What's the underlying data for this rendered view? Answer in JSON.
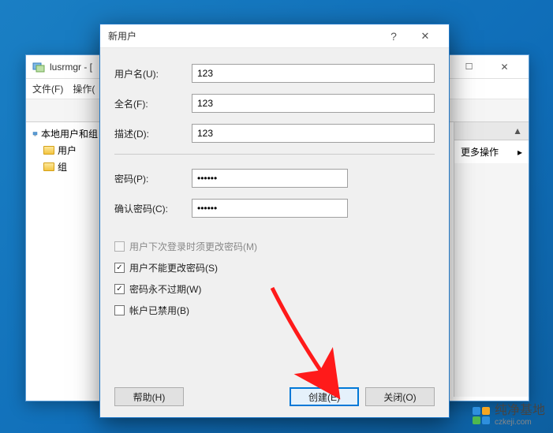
{
  "parent": {
    "title": "lusrmgr - [",
    "menu": {
      "file": "文件(F)",
      "action": "操作("
    },
    "tree": {
      "root": "本地用户和组",
      "users": "用户",
      "groups": "组"
    },
    "actions": {
      "header": "▲",
      "more": "更多操作",
      "arrow": "▸"
    }
  },
  "dialog": {
    "title": "新用户",
    "labels": {
      "username": "用户名(U):",
      "fullname": "全名(F):",
      "description": "描述(D):",
      "password": "密码(P):",
      "confirm": "确认密码(C):"
    },
    "values": {
      "username": "123",
      "fullname": "123",
      "description": "123",
      "password": "••••••",
      "confirm": "••••••"
    },
    "checks": {
      "must_change": "用户下次登录时须更改密码(M)",
      "cannot_change": "用户不能更改密码(S)",
      "never_expire": "密码永不过期(W)",
      "disabled": "帐户已禁用(B)"
    },
    "buttons": {
      "help": "帮助(H)",
      "create": "创建(E)",
      "close": "关闭(O)"
    }
  },
  "watermark": {
    "brand": "纯净基地",
    "url": "czkeji.com"
  }
}
